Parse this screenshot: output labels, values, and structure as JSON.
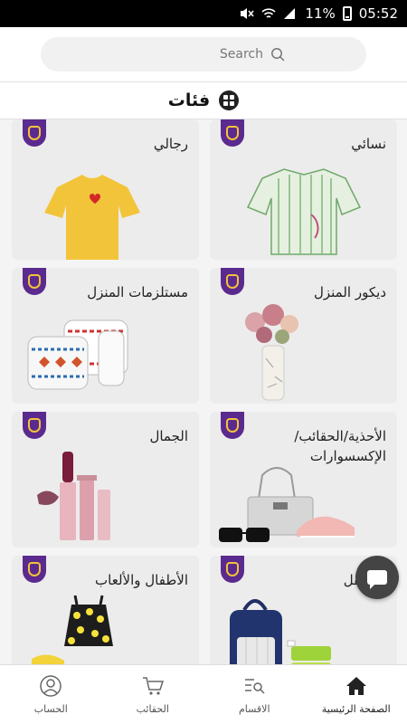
{
  "status_bar": {
    "battery": "11%",
    "time": "05:52"
  },
  "search": {
    "placeholder": "Search"
  },
  "header": {
    "title": "فئات"
  },
  "categories": [
    {
      "label": "نسائي",
      "image": "women-striped-shirt"
    },
    {
      "label": "رجالي",
      "image": "men-yellow-tshirt"
    },
    {
      "label": "ديكور المنزل",
      "image": "flower-vase"
    },
    {
      "label": "مستلزمات المنزل",
      "image": "cushions"
    },
    {
      "label": "الأحذية/الحقائب/الإكسسوارات",
      "image": "bag-shoes-sunglasses"
    },
    {
      "label": "الجمال",
      "image": "lipsticks"
    },
    {
      "label": "والطفل",
      "image": "diaper-bag"
    },
    {
      "label": "الأطفال والألعاب",
      "image": "kids-dress"
    }
  ],
  "bottom_nav": {
    "home": "الصفحة الرئيسية",
    "departments": "الاقسام",
    "bags": "الحقائب",
    "account": "الحساب"
  },
  "colors": {
    "badge": "#5b2a8e",
    "badge_border": "#f3c23a",
    "card_bg": "#ececec"
  }
}
